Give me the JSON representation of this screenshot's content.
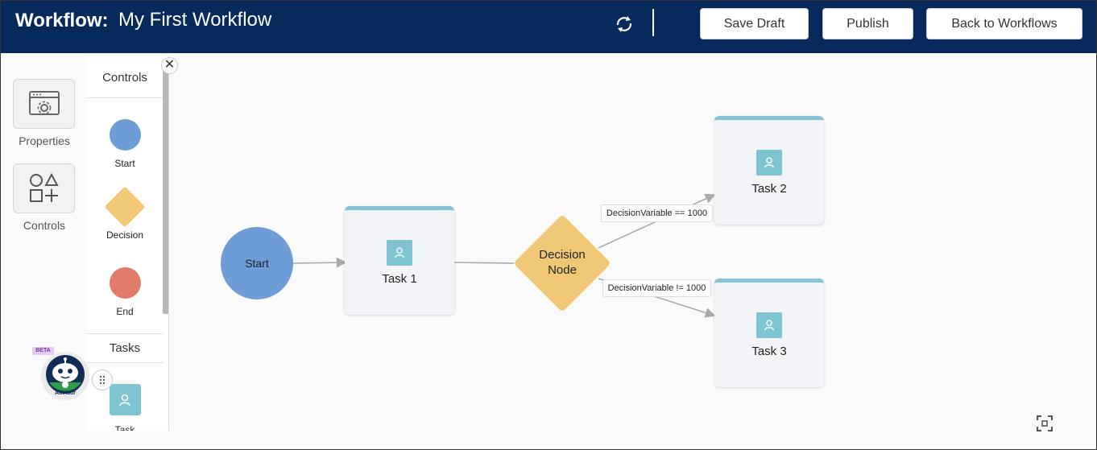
{
  "header": {
    "label": "Workflow:",
    "workflow_name": "My First Workflow",
    "buttons": {
      "save_draft": "Save Draft",
      "publish": "Publish",
      "back": "Back to Workflows"
    }
  },
  "rail": {
    "properties": "Properties",
    "controls": "Controls"
  },
  "palette": {
    "controls_heading": "Controls",
    "items": {
      "start": "Start",
      "decision": "Decision",
      "end": "End"
    },
    "tasks_heading": "Tasks",
    "task_item": "Task"
  },
  "advisor": {
    "beta": "BETA",
    "label": "Advisor"
  },
  "graph": {
    "start_label": "Start",
    "task1": "Task 1",
    "decision_line1": "Decision",
    "decision_line2": "Node",
    "task2": "Task 2",
    "task3": "Task 3",
    "edge_true": "DecisionVariable == 1000",
    "edge_false": "DecisionVariable != 1000"
  },
  "colors": {
    "header_bg": "#062a5c",
    "start": "#6e9dd6",
    "decision": "#f0c875",
    "end": "#e07a6a",
    "task_icon": "#7ec4d2",
    "task_accent": "#86c5d6"
  },
  "icons": [
    "sync-icon",
    "properties-icon",
    "shapes-icon",
    "close-icon",
    "user-icon",
    "advisor-robot-icon",
    "drag-handle-icon",
    "fit-screen-icon"
  ]
}
